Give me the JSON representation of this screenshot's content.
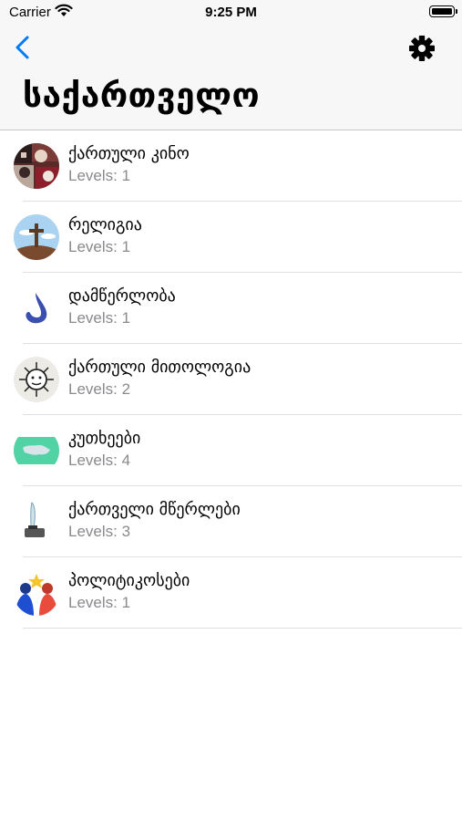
{
  "status": {
    "carrier": "Carrier",
    "time": "9:25 PM"
  },
  "nav": {
    "title": "საქართველო",
    "back_icon": "chevron-left-icon",
    "settings_icon": "gear-icon",
    "tint_color": "#007aff"
  },
  "items": [
    {
      "title": "ქართული კინო",
      "levels_label": "Levels:",
      "levels": "1",
      "icon": "film-collage-icon"
    },
    {
      "title": "რელიგია",
      "levels_label": "Levels:",
      "levels": "1",
      "icon": "cross-icon"
    },
    {
      "title": "დამწერლობა",
      "levels_label": "Levels:",
      "levels": "1",
      "icon": "ink-drop-icon"
    },
    {
      "title": "ქართული მითოლოგია",
      "levels_label": "Levels:",
      "levels": "2",
      "icon": "sun-face-icon"
    },
    {
      "title": "კუთხეები",
      "levels_label": "Levels:",
      "levels": "4",
      "icon": "map-icon"
    },
    {
      "title": "ქართველი მწერლები",
      "levels_label": "Levels:",
      "levels": "3",
      "icon": "quill-inkwell-icon"
    },
    {
      "title": "პოლიტიკოსები",
      "levels_label": "Levels:",
      "levels": "1",
      "icon": "politicians-icon"
    }
  ]
}
